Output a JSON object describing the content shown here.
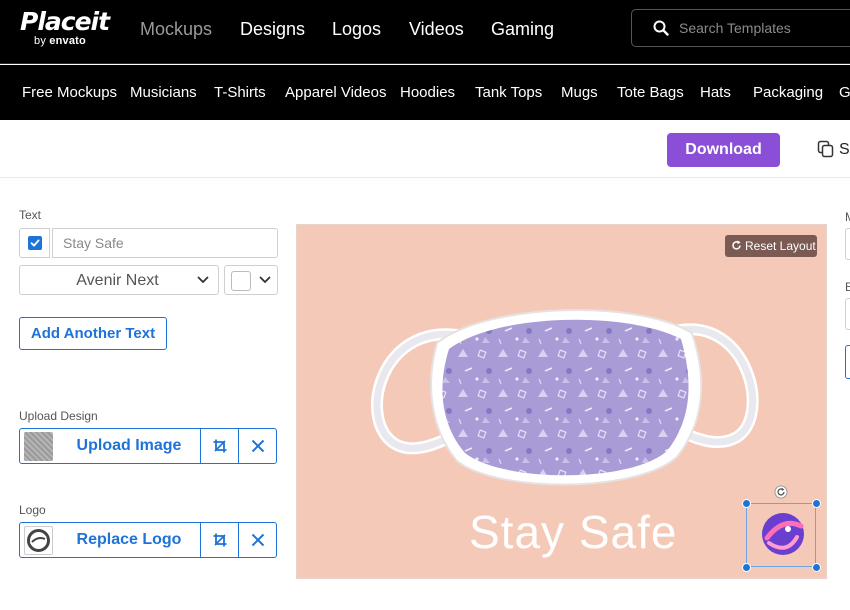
{
  "header": {
    "logo": {
      "brand": "Placeit",
      "by": "by",
      "envato": "envato"
    },
    "nav": [
      "Mockups",
      "Designs",
      "Logos",
      "Videos",
      "Gaming"
    ],
    "active_nav": "Mockups",
    "search": {
      "placeholder": "Search Templates"
    }
  },
  "categories": [
    "Free Mockups",
    "Musicians",
    "T-Shirts",
    "Apparel Videos",
    "Hoodies",
    "Tank Tops",
    "Mugs",
    "Tote Bags",
    "Hats",
    "Packaging",
    "Ga"
  ],
  "toolbar": {
    "download_label": "Download",
    "save_label": "Sa"
  },
  "editor": {
    "text_section": {
      "label": "Text",
      "checked": true,
      "text_placeholder": "Stay Safe",
      "font": "Avenir Next",
      "color": "#ffffff",
      "add_button": "Add Another Text"
    },
    "upload_section": {
      "label": "Upload Design",
      "button": "Upload Image"
    },
    "logo_section": {
      "label": "Logo",
      "button": "Replace Logo"
    }
  },
  "preview": {
    "reset_label": "Reset Layout",
    "overlay_text": "Stay Safe",
    "background": "#f5c9b8",
    "mask_color": "#a99bd6"
  },
  "right_panel": {
    "labels": [
      "M",
      "E"
    ]
  },
  "colors": {
    "accent": "#1e73d8",
    "download": "#8a4fd6",
    "nav_bg": "#000000"
  }
}
